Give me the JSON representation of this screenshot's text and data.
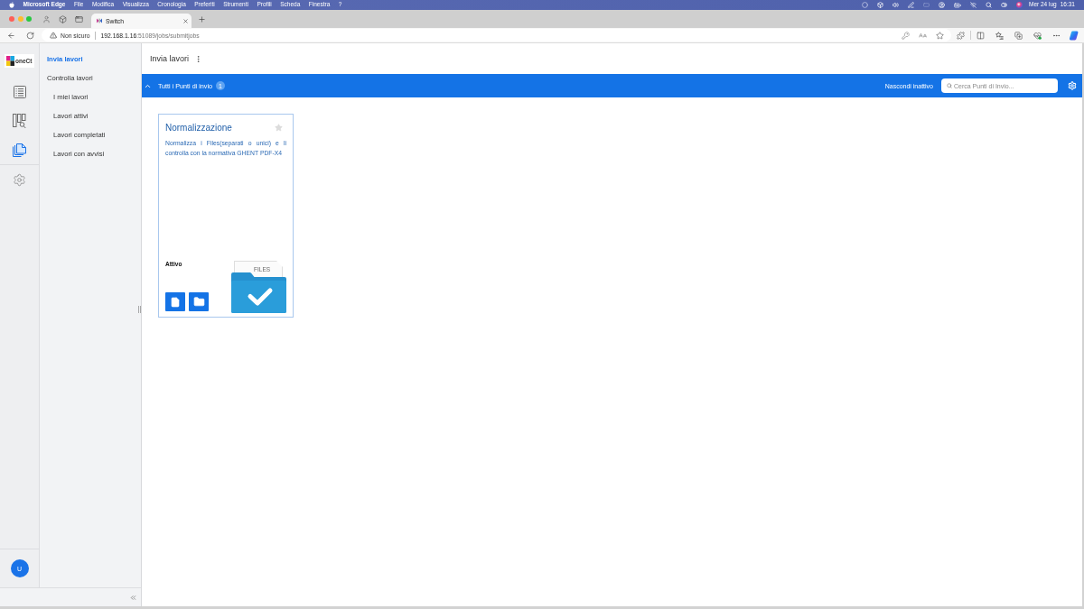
{
  "menu_bar": {
    "app_name": "Microsoft Edge",
    "menus": [
      "File",
      "Modifica",
      "Visualizza",
      "Cronologia",
      "Preferiti",
      "Strumenti",
      "Profili",
      "Scheda",
      "Finestra",
      "?"
    ],
    "date": "Mer 24 lug",
    "time": "16:31"
  },
  "browser": {
    "tabs": [
      {
        "title": "Switch",
        "selected": true
      }
    ],
    "security": "Non sicuro",
    "url_host": "192.168.1.16",
    "url_path": ":51089/jobs/submitjobs"
  },
  "rail": {
    "logo": "oneCt",
    "items": [
      {
        "kind": "list",
        "selected": false
      },
      {
        "kind": "board",
        "selected": false
      },
      {
        "kind": "files",
        "selected": true
      },
      {
        "kind": "settings",
        "selected": false
      }
    ],
    "avatar": "U"
  },
  "nav": {
    "items": [
      {
        "label": "Invia lavori",
        "selected": true
      },
      {
        "label": "Controlla lavori",
        "selected": false,
        "children": [
          {
            "label": "I miei lavori",
            "selected": false
          },
          {
            "label": "Lavori attivi",
            "selected": false
          },
          {
            "label": "Lavori completati",
            "selected": false
          },
          {
            "label": "Lavori con avvisi",
            "selected": false
          }
        ]
      }
    ]
  },
  "page": {
    "title": "Invia lavori"
  },
  "toolbar": {
    "group": {
      "label": "Tutti i Punti di invio",
      "count": "1",
      "expanded": true
    },
    "hide_inactive": "Nascondi inattivo",
    "search": {
      "placeholder": "Cerca Punti di Invio..."
    }
  },
  "cards": [
    {
      "title": "Normalizzazione",
      "starred": false,
      "description": "Normalizza i Files(separati o unici) e li controlla con la normativa GHENT PDF-X4",
      "status": "Attivo",
      "illustration_label": "FILES"
    }
  ]
}
